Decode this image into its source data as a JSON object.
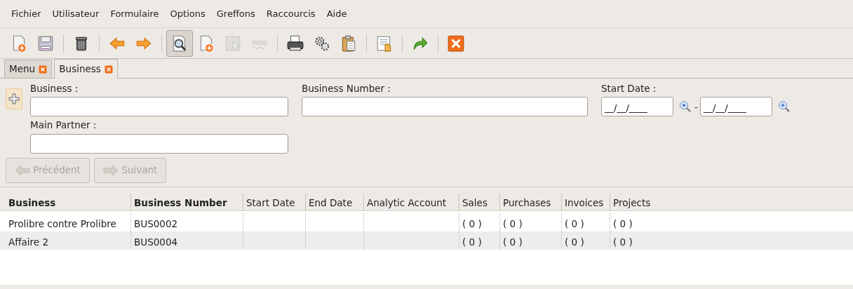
{
  "menu": [
    {
      "label": "Fichier"
    },
    {
      "label": "Utilisateur"
    },
    {
      "label": "Formulaire"
    },
    {
      "label": "Options"
    },
    {
      "label": "Greffons"
    },
    {
      "label": "Raccourcis"
    },
    {
      "label": "Aide"
    }
  ],
  "toolbar": [
    [
      {
        "kind": "new",
        "disabled": false,
        "pressed": false
      },
      {
        "kind": "save",
        "disabled": false,
        "pressed": false
      }
    ],
    [
      {
        "kind": "delete",
        "disabled": false,
        "pressed": false
      }
    ],
    [
      {
        "kind": "previous",
        "disabled": false,
        "pressed": false
      },
      {
        "kind": "next",
        "disabled": false,
        "pressed": false
      }
    ],
    [
      {
        "kind": "search",
        "disabled": false,
        "pressed": true
      },
      {
        "kind": "new",
        "disabled": false,
        "pressed": false
      },
      {
        "kind": "switch",
        "disabled": true,
        "pressed": false
      },
      {
        "kind": "spell",
        "disabled": true,
        "pressed": false
      }
    ],
    [
      {
        "kind": "print",
        "disabled": false,
        "pressed": false
      },
      {
        "kind": "action",
        "disabled": false,
        "pressed": false
      },
      {
        "kind": "clipboard",
        "disabled": false,
        "pressed": false
      }
    ],
    [
      {
        "kind": "form",
        "disabled": false,
        "pressed": false
      }
    ],
    [
      {
        "kind": "redo",
        "disabled": false,
        "pressed": false
      }
    ],
    [
      {
        "kind": "close",
        "disabled": false,
        "pressed": false
      }
    ]
  ],
  "tabs": [
    {
      "label": "Menu",
      "selected": false
    },
    {
      "label": "Business",
      "selected": true
    }
  ],
  "search_form": {
    "fields": [
      {
        "label": "Business :",
        "kind": "text"
      },
      {
        "label": "Business Number :",
        "kind": "text"
      },
      {
        "label": "Start Date :",
        "kind": "date_range",
        "from": "__/__/____",
        "separator": "-",
        "to": "__/__/____"
      },
      {
        "label": "Main Partner :",
        "kind": "text"
      }
    ],
    "buttons": [
      {
        "label": "Précédent",
        "kind": "previous",
        "disabled": true
      },
      {
        "label": "Suivant",
        "kind": "next",
        "disabled": true
      }
    ]
  },
  "table": {
    "columns": [
      {
        "label": "Business",
        "emphasized": true
      },
      {
        "label": "Business Number",
        "emphasized": true
      },
      {
        "label": "Start Date",
        "emphasized": false
      },
      {
        "label": "End Date",
        "emphasized": false
      },
      {
        "label": "Analytic Account",
        "emphasized": false
      },
      {
        "label": "Sales",
        "emphasized": false
      },
      {
        "label": "Purchases",
        "emphasized": false
      },
      {
        "label": "Invoices",
        "emphasized": false
      },
      {
        "label": "Projects",
        "emphasized": false
      }
    ],
    "rows": [
      [
        "Prolibre contre Prolibre",
        "BUS0002",
        "",
        "",
        "",
        "( 0 )",
        "( 0 )",
        "( 0 )",
        "( 0 )"
      ],
      [
        "Affaire 2",
        "BUS0004",
        "",
        "",
        "",
        "( 0 )",
        "( 0 )",
        "( 0 )",
        "( 0 )"
      ]
    ]
  }
}
